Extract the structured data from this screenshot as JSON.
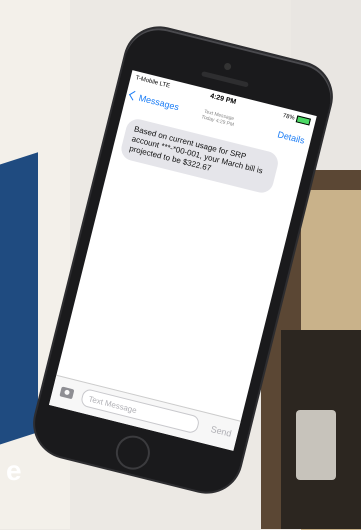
{
  "status": {
    "carrier": "T-Mobile  LTE",
    "time": "4:29 PM",
    "battery": "78%"
  },
  "nav": {
    "back_label": "Messages",
    "header_type": "Text Message",
    "header_time": "Today 4:29 PM",
    "details_label": "Details"
  },
  "message": {
    "text": "Based on current usage for SRP account ***-*00-001, your March bill is projected to be $322.67"
  },
  "input": {
    "placeholder": "Text Message",
    "send_label": "Send"
  },
  "background": {
    "letter": "e"
  },
  "colors": {
    "ios_blue": "#1a7cf5",
    "bubble_gray": "#e5e5ea",
    "battery_green": "#4cd964"
  }
}
